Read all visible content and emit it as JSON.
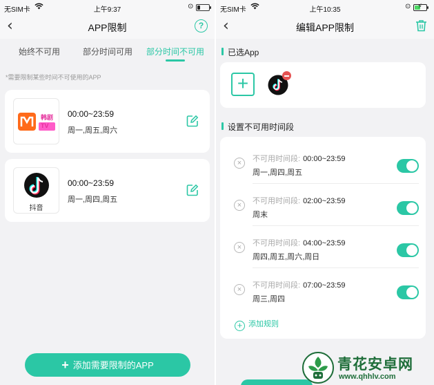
{
  "left_screen": {
    "status": {
      "carrier": "无SIM卡",
      "time": "上午9:37",
      "battery_level": 0.25
    },
    "nav": {
      "title": "APP限制",
      "help": "?"
    },
    "tabs": [
      {
        "label": "始终不可用"
      },
      {
        "label": "部分时间可用"
      },
      {
        "label": "部分时间不可用",
        "active": true
      }
    ],
    "hint": "*需要限制某些时间不可使用的APP",
    "apps": [
      {
        "icon": "mango-tv-icon",
        "icon_caption": "韩剧\nTV",
        "time": "00:00~23:59",
        "days": "周一,周五,周六"
      },
      {
        "icon": "douyin-icon",
        "name": "抖音",
        "time": "00:00~23:59",
        "days": "周一,周四,周五"
      }
    ],
    "add_button": {
      "plus": "+",
      "label": "添加需要限制的APP"
    }
  },
  "right_screen": {
    "status": {
      "carrier": "无SIM卡",
      "time": "上午10:35",
      "battery_level": 0.5,
      "charging": true
    },
    "nav": {
      "title": "编辑APP限制"
    },
    "selected_section": {
      "title": "已选App",
      "add_symbol": "+"
    },
    "rules_section": {
      "title": "设置不可用时间段"
    },
    "rule_label": "不可用时间段:",
    "rules": [
      {
        "range": "00:00~23:59",
        "days": "周一,周四,周五",
        "enabled": true
      },
      {
        "range": "02:00~23:59",
        "days": "周末",
        "enabled": true
      },
      {
        "range": "04:00~23:59",
        "days": "周四,周五,周六,周日",
        "enabled": true
      },
      {
        "range": "07:00~23:59",
        "days": "周三,周四",
        "enabled": true
      }
    ],
    "add_rule": {
      "symbol": "+",
      "label": "添加规则"
    }
  },
  "watermark": {
    "title": "青花安卓网",
    "url": "www.qhhlv.com"
  },
  "colors": {
    "accent": "#2bc7a5",
    "danger": "#e55353",
    "background": "#f2f2f4",
    "card": "#ffffff"
  }
}
